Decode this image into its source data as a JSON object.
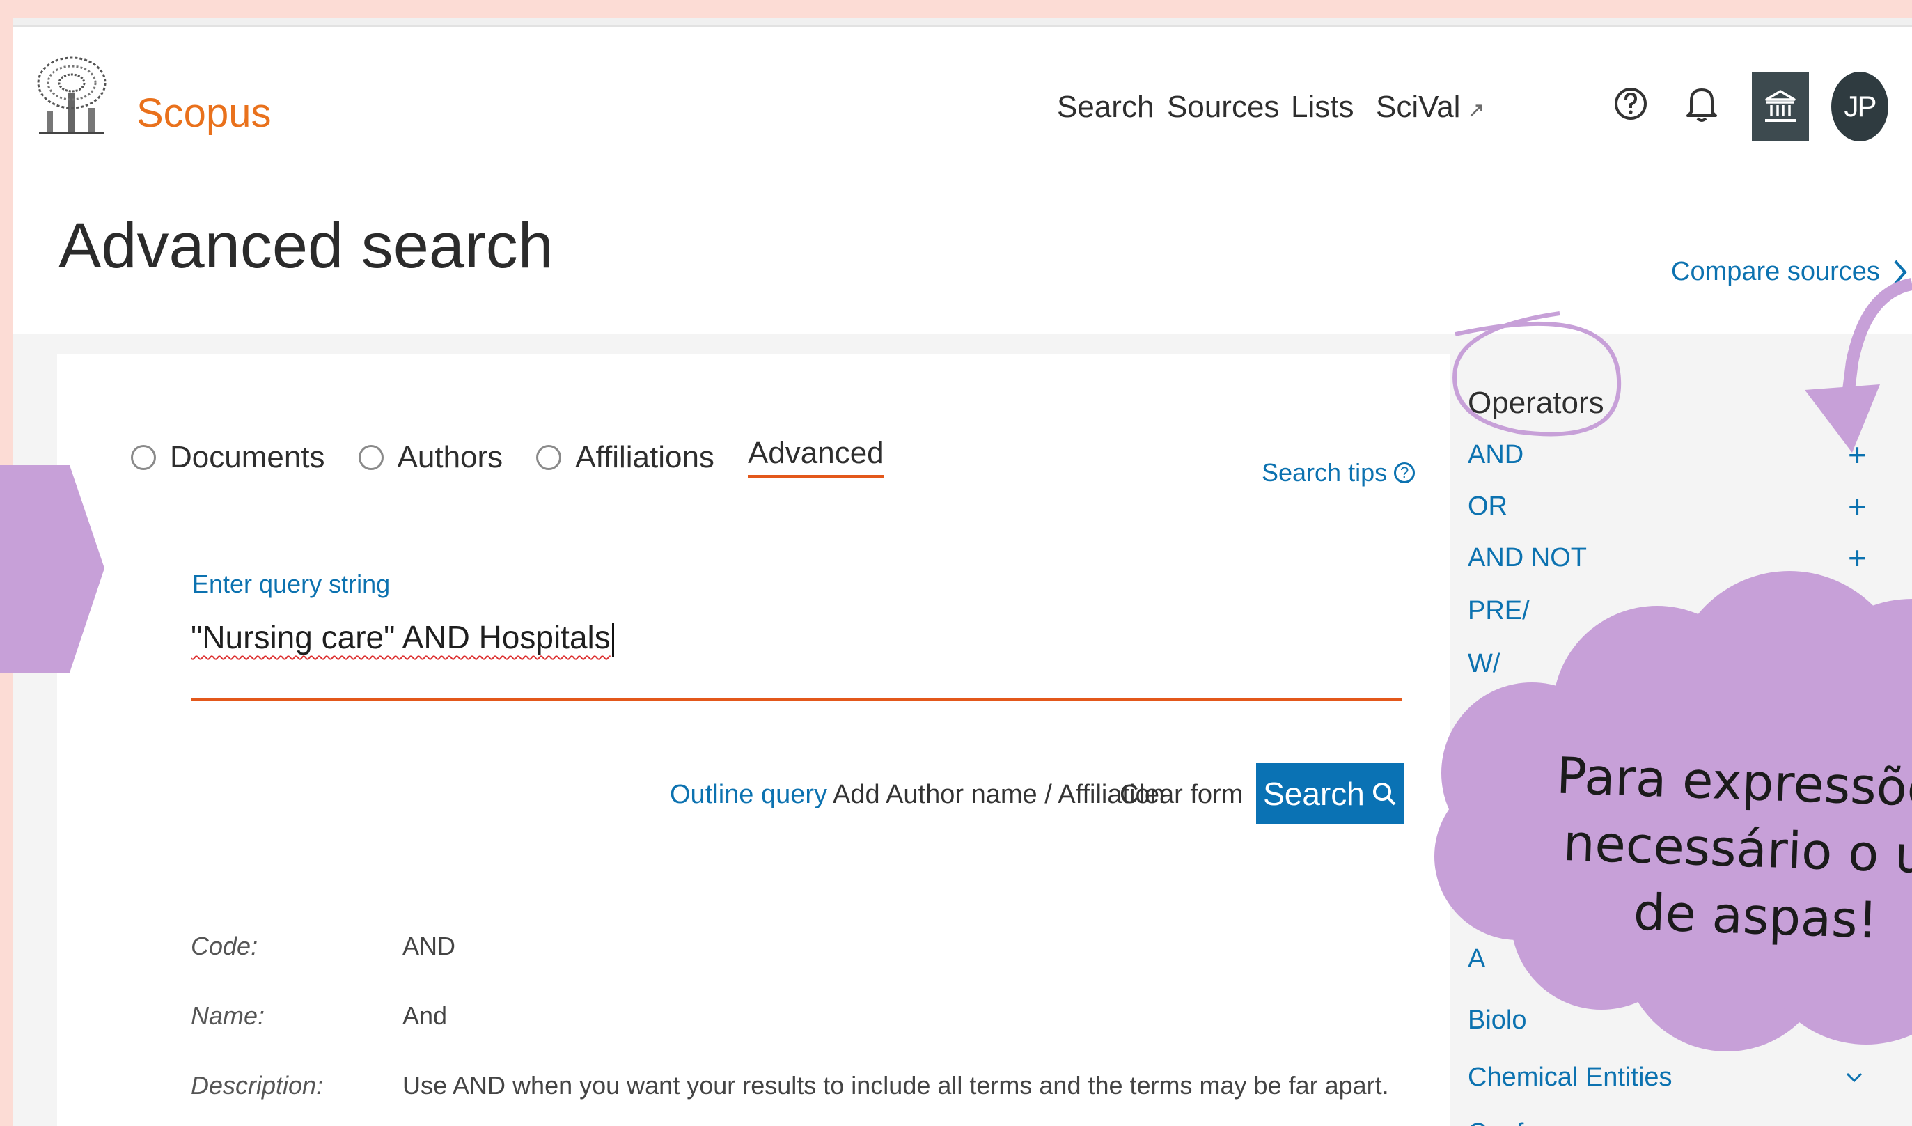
{
  "header": {
    "brand": "Scopus",
    "nav": [
      "Search",
      "Sources",
      "Lists",
      "SciVal"
    ],
    "nav_external_icon": "↗",
    "avatar_initials": "JP"
  },
  "page": {
    "title": "Advanced search",
    "compare_sources": "Compare sources"
  },
  "search_type": {
    "options": [
      "Documents",
      "Authors",
      "Affiliations"
    ],
    "active_tab": "Advanced",
    "search_tips": "Search tips"
  },
  "query": {
    "label": "Enter query string",
    "value": "\"Nursing care\"  AND Hospitals"
  },
  "actions": {
    "outline_query": "Outline query",
    "add_author": "Add Author name / Affiliation",
    "clear_form": "Clear form",
    "search_button": "Search"
  },
  "details": {
    "code_label": "Code:",
    "code_value": "AND",
    "name_label": "Name:",
    "name_value": "And",
    "description_label": "Description:",
    "description_value": "Use AND when you want your results to include all terms and the terms may be far apart."
  },
  "operators": {
    "title": "Operators",
    "items": [
      "AND",
      "OR",
      "AND NOT",
      "PRE/",
      "W/"
    ],
    "partial_items": [
      "A",
      "A",
      "Biolo"
    ],
    "chemical_entities": "Chemical Entities",
    "conferences": "Conferences"
  },
  "annotation": {
    "cloud_lines": [
      "Para expressões",
      "necessário o us",
      "de aspas!"
    ],
    "color": "#c7a0d8"
  },
  "colors": {
    "accent_orange": "#e3581b",
    "link_blue": "#0c72b0",
    "search_button_blue": "#0a72b4",
    "brand_orange": "#e9711c",
    "background_pink": "#fcdcd5"
  }
}
